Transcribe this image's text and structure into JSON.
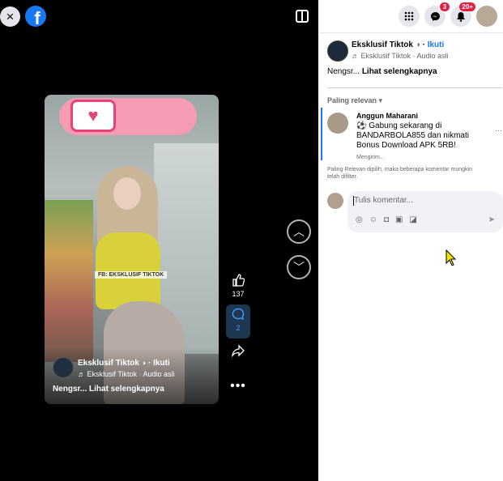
{
  "viewer": {
    "close_icon": "×",
    "fb_letter": "f",
    "watermark": "FB: EKSKLUSIF TIKTOK",
    "overlay": {
      "name": "Eksklusif Tiktok",
      "follow": "Ikuti",
      "audio": "♬ Eksklusif Tiktok · Audio asli",
      "caption": "Nengsr... Lihat selengkapnya"
    },
    "actions": {
      "likes": "137",
      "comments": "2"
    }
  },
  "topbar": {
    "messenger_badge": "3",
    "notifications_badge": "20+"
  },
  "post": {
    "page_name": "Eksklusif Tiktok",
    "follow": "Ikuti",
    "audio": "♬ Eksklusif Tiktok · Audio asli",
    "caption_prefix": "Nengsr...",
    "see_more": "Lihat selengkapnya"
  },
  "comments": {
    "sort_label": "Paling relevan",
    "items": [
      {
        "author": "Anggun Maharani",
        "lines": [
          "⚽ Gabung sekarang di",
          "BANDARBOLA855 dan nikmati",
          "Bonus Download APK 5RB!"
        ],
        "status": "Mengirim..."
      }
    ],
    "filter_note_lines": [
      "Paling Relevan dipilih, maka beberapa komentar mungkin",
      "telah difilter."
    ],
    "input_placeholder": "Tulis komentar..."
  },
  "colors": {
    "facebook_blue": "#1877f2",
    "badge_red": "#e41e3f"
  },
  "icons": {
    "close": "close-icon",
    "facebook": "facebook-logo-icon",
    "panel_toggle": "panel-toggle-icon",
    "chevron_up": "chevron-up-icon",
    "chevron_down": "chevron-down-icon",
    "like": "thumbs-up-icon",
    "comment": "comment-bubble-icon",
    "share": "share-arrow-icon",
    "more": "more-dots-icon",
    "menu": "grid-menu-icon",
    "messenger": "messenger-icon",
    "bell": "bell-icon",
    "globe": "globe-icon",
    "cursor": "mouse-cursor-icon"
  }
}
